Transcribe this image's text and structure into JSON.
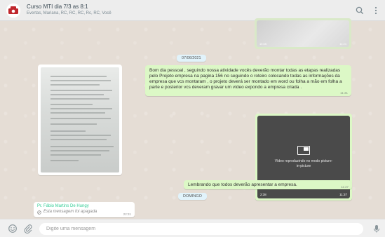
{
  "header": {
    "title": "Curso MTI dia 7/3 as 8:1",
    "participants": "Evertas, Mariana, RC, RC, RC, Rc, RC, Você",
    "icons": [
      "search-icon",
      "menu-icon"
    ]
  },
  "top_image": {
    "size": "15 kB",
    "time": "11:24"
  },
  "date_label_1": "07/06/2021",
  "text_message": {
    "text": "Bom dia pessoal , seguindo nossa atividade vocês deverão montar todas as etapas realizadas pelo Projeto empresa na pagina 156 no seguindo o roteiro colocando todas as informações da empresa que vcs montaram , o projeto deverá ser montado em word ou folha a mão em folha a parte e posterior vcs deveram gravar um vídeo expondo a empresa criada .",
    "time": "11:31"
  },
  "video_message": {
    "caption": "Vídeo reproduzindo no modo picture-in-picture",
    "duration": "2:38",
    "time": "11:37"
  },
  "reminder_message": {
    "text": "Lembrando que todos deverão apresentar a empresa.",
    "time": "11:37"
  },
  "date_label_2": "DOMINGO",
  "incoming_deleted": {
    "sender": "Pr. Fábio Martins De Hungy",
    "text": "Esta mensagem foi apagada",
    "time": "22:31"
  },
  "footer": {
    "placeholder": "Digite uma mensagem",
    "icons": [
      "emoji-icon",
      "attach-icon",
      "mic-icon"
    ]
  },
  "colors": {
    "chat_bg": "#e5ddd5",
    "outgoing": "#dcf8c6",
    "incoming": "#ffffff",
    "header_bg": "#ededed",
    "sender_name": "#35cd96"
  }
}
